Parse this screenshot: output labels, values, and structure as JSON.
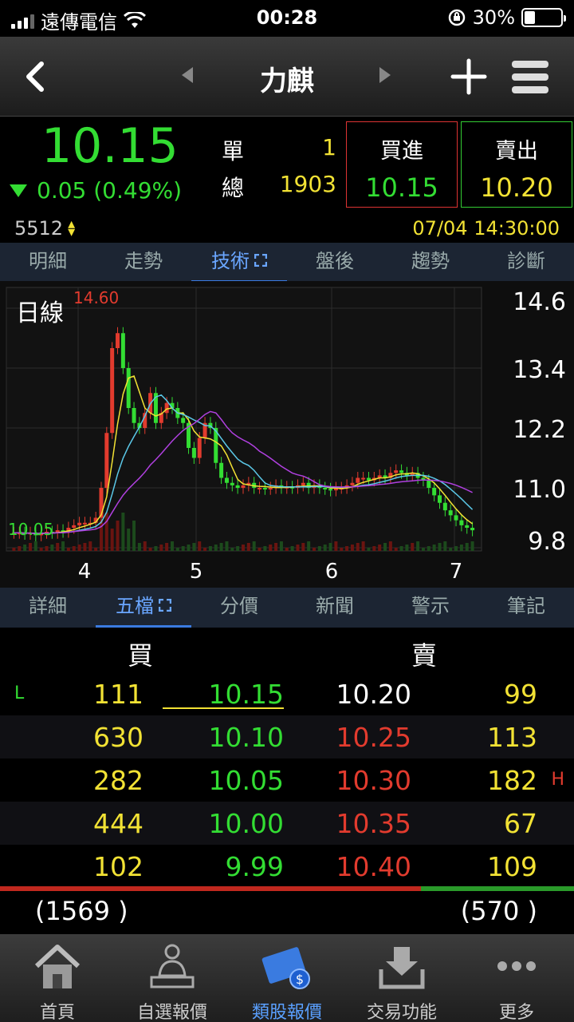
{
  "status_bar": {
    "carrier": "遠傳電信",
    "time": "00:28",
    "battery_percent": "30%",
    "battery_level": 0.3
  },
  "nav": {
    "title": "力麒"
  },
  "quote": {
    "price": "10.15",
    "change": "0.05 (0.49%)",
    "single_label": "單",
    "single_value": "1",
    "total_label": "總",
    "total_value": "1903",
    "buy_label": "買進",
    "buy_price": "10.15",
    "sell_label": "賣出",
    "sell_price": "10.20",
    "code": "5512",
    "datetime": "07/04 14:30:00"
  },
  "top_tabs": [
    "明細",
    "走勢",
    "技術",
    "盤後",
    "趨勢",
    "診斷"
  ],
  "top_tab_active": 2,
  "chart": {
    "period_label": "日線",
    "high_label": "14.60",
    "low_label": "10.05",
    "y_ticks": [
      "14.6",
      "13.4",
      "12.2",
      "11.0",
      "9.8"
    ],
    "x_ticks": [
      "4",
      "5",
      "6",
      "7"
    ]
  },
  "chart_data": {
    "type": "candlestick",
    "ylim": [
      9.8,
      14.6
    ],
    "x_ticks": [
      "4",
      "5",
      "6",
      "7"
    ],
    "y_ticks": [
      14.6,
      13.4,
      12.2,
      11.0,
      9.8
    ],
    "high_marked": 14.6,
    "low_marked": 10.05,
    "close": [
      10.1,
      10.1,
      10.08,
      10.1,
      10.05,
      10.1,
      10.12,
      10.1,
      10.15,
      10.12,
      10.2,
      10.25,
      10.3,
      10.3,
      10.3,
      10.4,
      11.0,
      12.1,
      13.8,
      14.1,
      13.4,
      12.6,
      12.3,
      12.2,
      12.5,
      12.9,
      12.3,
      12.5,
      12.7,
      12.6,
      12.4,
      12.3,
      11.8,
      11.6,
      12.0,
      12.3,
      12.2,
      11.5,
      11.2,
      11.1,
      11.05,
      11.0,
      11.05,
      11.1,
      11.0,
      11.0,
      10.98,
      11.0,
      11.05,
      11.0,
      11.02,
      11.0,
      11.05,
      11.1,
      11.0,
      11.05,
      11.0,
      10.98,
      10.95,
      11.0,
      11.0,
      11.05,
      11.1,
      11.2,
      11.2,
      11.15,
      11.2,
      11.25,
      11.2,
      11.3,
      11.35,
      11.3,
      11.25,
      11.3,
      11.2,
      11.15,
      11.0,
      10.85,
      10.7,
      10.55,
      10.45,
      10.35,
      10.25,
      10.2,
      10.15
    ]
  },
  "bottom_tabs": [
    "詳細",
    "五檔",
    "分價",
    "新聞",
    "警示",
    "筆記"
  ],
  "bottom_tab_active": 1,
  "book": {
    "buy_header": "買",
    "sell_header": "賣",
    "rows": [
      {
        "marker_left": "L",
        "bid_qty": "111",
        "bid": "10.15",
        "ask": "10.20",
        "ask_qty": "99",
        "marker_right": ""
      },
      {
        "marker_left": "",
        "bid_qty": "630",
        "bid": "10.10",
        "ask": "10.25",
        "ask_qty": "113",
        "marker_right": ""
      },
      {
        "marker_left": "",
        "bid_qty": "282",
        "bid": "10.05",
        "ask": "10.30",
        "ask_qty": "182",
        "marker_right": "H"
      },
      {
        "marker_left": "",
        "bid_qty": "444",
        "bid": "10.00",
        "ask": "10.35",
        "ask_qty": "67",
        "marker_right": ""
      },
      {
        "marker_left": "",
        "bid_qty": "102",
        "bid": "9.99",
        "ask": "10.40",
        "ask_qty": "109",
        "marker_right": ""
      }
    ],
    "total_bid": "(1569 )",
    "total_ask": "(570 )",
    "bid_ratio": 0.733
  },
  "tabbar": [
    {
      "label": "首頁",
      "icon": "home-icon"
    },
    {
      "label": "自選報價",
      "icon": "person-desk-icon"
    },
    {
      "label": "類股報價",
      "icon": "film-coin-icon"
    },
    {
      "label": "交易功能",
      "icon": "inbox-download-icon"
    },
    {
      "label": "更多",
      "icon": "more-dots-icon"
    }
  ],
  "tabbar_active": 2,
  "colors": {
    "up": "#e23b2e",
    "down": "#33dd33",
    "yellow": "#f2e234",
    "accent": "#3a7be0"
  }
}
